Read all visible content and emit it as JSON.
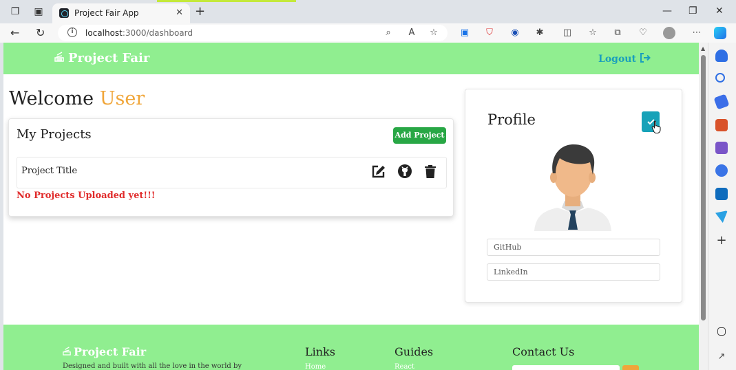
{
  "browser": {
    "tab_title": "Project Fair App",
    "url_host": "localhost",
    "url_rest": ":3000/dashboard"
  },
  "header": {
    "brand": "Project Fair",
    "logout_label": "Logout"
  },
  "welcome": {
    "prefix": "Welcome",
    "user": "User"
  },
  "projects": {
    "heading": "My Projects",
    "add_button": "Add Project",
    "row_title": "Project Title",
    "empty_message": "No Projects Uploaded yet!!!"
  },
  "profile": {
    "heading": "Profile",
    "github_placeholder": "GitHub",
    "linkedin_placeholder": "LinkedIn"
  },
  "footer": {
    "brand": "Project Fair",
    "tagline": "Designed and built with all the love in the world by",
    "links_heading": "Links",
    "links_first": "Home",
    "guides_heading": "Guides",
    "guides_first": "React",
    "contact_heading": "Contact Us"
  },
  "colors": {
    "header_bg": "#90ee90",
    "accent": "#f0a63a",
    "add_btn": "#28a745",
    "check_btn": "#17a2b8",
    "error_text": "#e02b2b",
    "logout_text": "#1a9fbc"
  }
}
